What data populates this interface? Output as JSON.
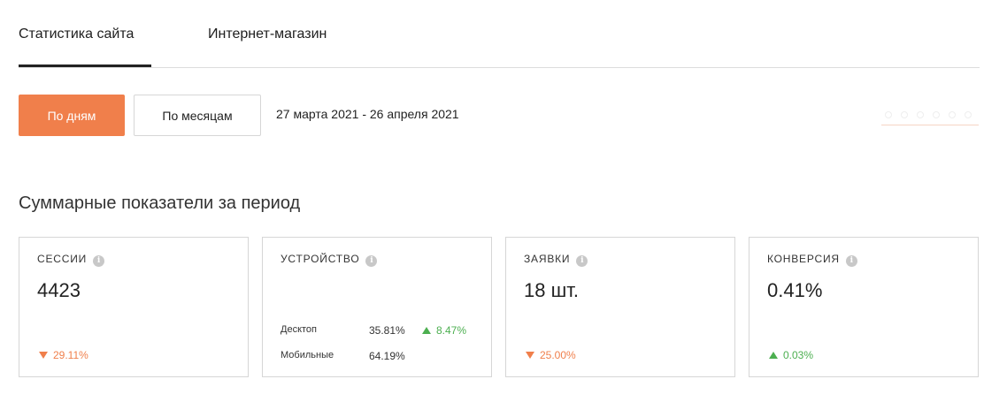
{
  "tabs": [
    {
      "label": "Статистика сайта",
      "active": true
    },
    {
      "label": "Интернет-магазин",
      "active": false
    }
  ],
  "period_buttons": {
    "by_day": "По дням",
    "by_month": "По месяцам",
    "selected": "by_day"
  },
  "date_range": "27 марта 2021 - 26 апреля 2021",
  "section_title": "Суммарные показатели за период",
  "info_icon_glyph": "i",
  "cards": {
    "sessions": {
      "label": "СЕССИИ",
      "value": "4423",
      "delta": "29.11%",
      "direction": "down"
    },
    "device": {
      "label": "УСТРОЙСТВО",
      "rows": [
        {
          "name": "Десктоп",
          "percent": "35.81%",
          "delta": "8.47%",
          "direction": "up"
        },
        {
          "name": "Мобильные",
          "percent": "64.19%"
        }
      ]
    },
    "requests": {
      "label": "ЗАЯВКИ",
      "value": "18 шт.",
      "delta": "25.00%",
      "direction": "down"
    },
    "conversion": {
      "label": "КОНВЕРСИЯ",
      "value": "0.41%",
      "delta": "0.03%",
      "direction": "up"
    }
  },
  "colors": {
    "accent": "#f07f4b",
    "positive": "#4caf50",
    "negative": "#f07f4b",
    "border": "#d6d6d6"
  }
}
